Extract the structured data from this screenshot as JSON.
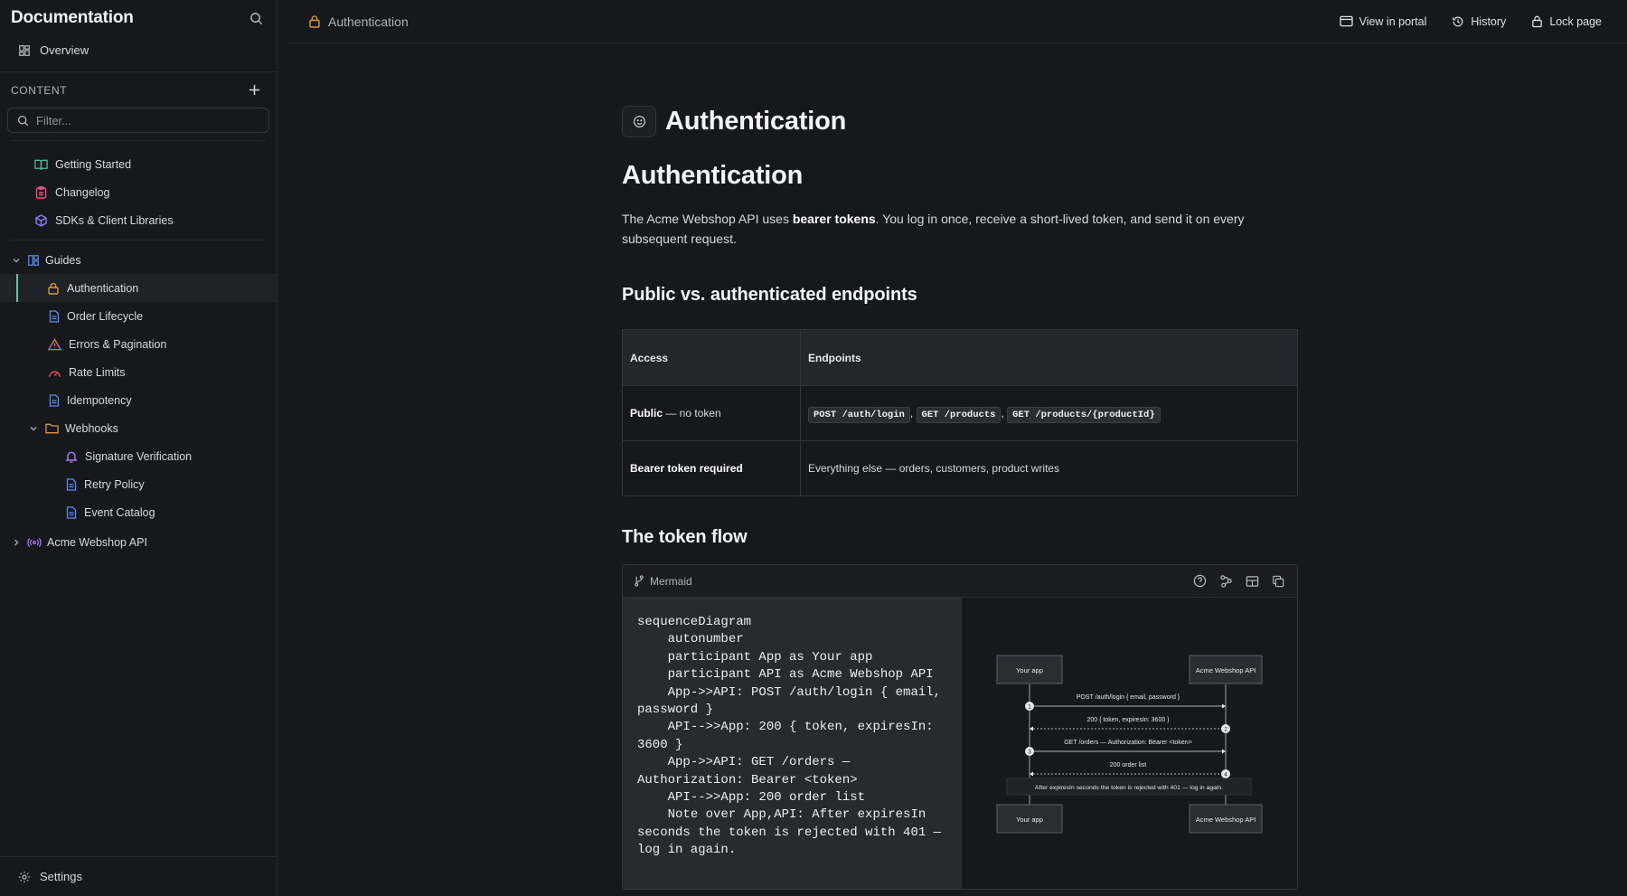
{
  "sidebar": {
    "title": "Documentation",
    "overview": "Overview",
    "section_label": "CONTENT",
    "filter_placeholder": "Filter...",
    "top_items": [
      {
        "label": "Getting Started",
        "icon": "book-icon",
        "color": "#4fb98f"
      },
      {
        "label": "Changelog",
        "icon": "clipboard-icon",
        "color": "#e0567a"
      },
      {
        "label": "SDKs & Client Libraries",
        "icon": "cube-icon",
        "color": "#8b7cf6"
      }
    ],
    "guides": {
      "label": "Guides",
      "items": [
        {
          "label": "Authentication",
          "icon": "lock-icon",
          "color": "#d9963a",
          "active": true
        },
        {
          "label": "Order Lifecycle",
          "icon": "document-icon",
          "color": "#5b8def"
        },
        {
          "label": "Errors & Pagination",
          "icon": "warning-icon",
          "color": "#e0793a"
        },
        {
          "label": "Rate Limits",
          "icon": "gauge-icon",
          "color": "#e05252"
        },
        {
          "label": "Idempotency",
          "icon": "document-icon",
          "color": "#5b8def"
        }
      ],
      "webhooks": {
        "label": "Webhooks",
        "items": [
          {
            "label": "Signature Verification",
            "icon": "bell-icon",
            "color": "#a77cf0"
          },
          {
            "label": "Retry Policy",
            "icon": "document-icon",
            "color": "#5b8def"
          },
          {
            "label": "Event Catalog",
            "icon": "document-icon",
            "color": "#5b8def"
          }
        ]
      }
    },
    "api": {
      "label": "Acme Webshop API",
      "icon": "broadcast-icon",
      "color": "#a77cf0"
    },
    "footer": "Settings"
  },
  "topbar": {
    "breadcrumb": "Authentication",
    "actions": [
      "View in portal",
      "History",
      "Lock page"
    ]
  },
  "page": {
    "title": "Authentication",
    "h1": "Authentication",
    "lead_pre": "The Acme Webshop API uses ",
    "lead_bold": "bearer tokens",
    "lead_post": ". You log in once, receive a short-lived token, and send it on every subsequent request.",
    "h2_endpoints": "Public vs. authenticated endpoints",
    "table": {
      "headers": [
        "Access",
        "Endpoints"
      ],
      "row1": {
        "access_bold": "Public",
        "access_rest": " — no token",
        "codes": [
          "POST /auth/login",
          "GET /products",
          "GET /products/{productId}"
        ],
        "sep": ","
      },
      "row2": {
        "access_bold": "Bearer token required",
        "endpoints": "Everything else — orders, customers, product writes"
      }
    },
    "h2_flow": "The token flow",
    "mermaid": {
      "label": "Mermaid",
      "code": "sequenceDiagram\n    autonumber\n    participant App as Your app\n    participant API as Acme Webshop API\n    App->>API: POST /auth/login { email, password }\n    API-->>App: 200 { token, expiresIn: 3600 }\n    App->>API: GET /orders — Authorization: Bearer <token>\n    API-->>App: 200 order list\n    Note over App,API: After expiresIn seconds the token is rejected with 401 — log in again.",
      "diagram": {
        "participant_app": "Your app",
        "participant_api": "Acme Webshop API",
        "messages": [
          "POST /auth/login { email, password }",
          "200 { token, expiresIn: 3600 }",
          "GET /orders — Authorization: Bearer <token>",
          "200 order list"
        ],
        "numbers": [
          "1",
          "2",
          "3",
          "4"
        ],
        "note": "After expiresIn seconds the token is rejected with 401 — log in again."
      }
    }
  }
}
